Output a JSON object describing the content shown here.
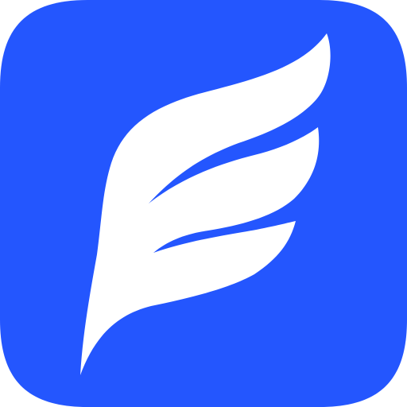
{
  "icon": {
    "name": "feather-wing-logo-icon",
    "colors": {
      "tile": "#2456FE",
      "mark": "#FFFFFF",
      "page": "#FFFFFF"
    }
  }
}
